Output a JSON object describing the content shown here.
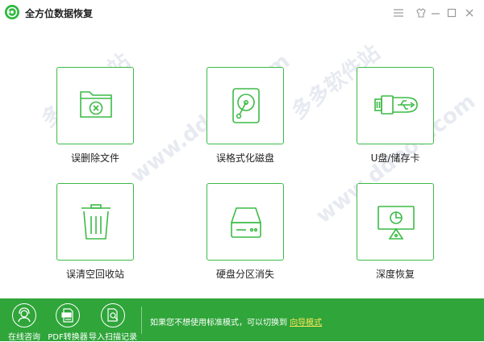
{
  "app": {
    "title": "全方位数据恢复",
    "icon": "recovery-logo-icon",
    "accent_color": "#2fa53a"
  },
  "window_controls": [
    {
      "name": "menu-icon"
    },
    {
      "name": "skin-icon"
    },
    {
      "name": "minimize-icon"
    },
    {
      "name": "maximize-icon"
    },
    {
      "name": "close-icon"
    }
  ],
  "tiles": [
    {
      "id": "deleted-files",
      "label": "误删除文件",
      "icon": "folder-x-icon"
    },
    {
      "id": "formatted-disk",
      "label": "误格式化磁盘",
      "icon": "hard-disk-icon"
    },
    {
      "id": "usb-card",
      "label": "U盘/储存卡",
      "icon": "usb-drive-icon"
    },
    {
      "id": "recycle-bin",
      "label": "误清空回收站",
      "icon": "trash-bin-icon"
    },
    {
      "id": "lost-partition",
      "label": "硬盘分区消失",
      "icon": "drive-partition-icon"
    },
    {
      "id": "deep-recovery",
      "label": "深度恢复",
      "icon": "monitor-chart-icon"
    }
  ],
  "footer": {
    "buttons": [
      {
        "label": "在线咨询",
        "icon": "headset-icon"
      },
      {
        "label": "PDF转换器",
        "icon": "pdf-icon"
      },
      {
        "label": "导入扫描记录",
        "icon": "import-scan-icon"
      }
    ],
    "notice_text": "如果您不想使用标准模式，可以切换到",
    "notice_link": "向导模式"
  },
  "watermark": {
    "text": "多多软件站",
    "url_text": "www.ddooo.com"
  }
}
